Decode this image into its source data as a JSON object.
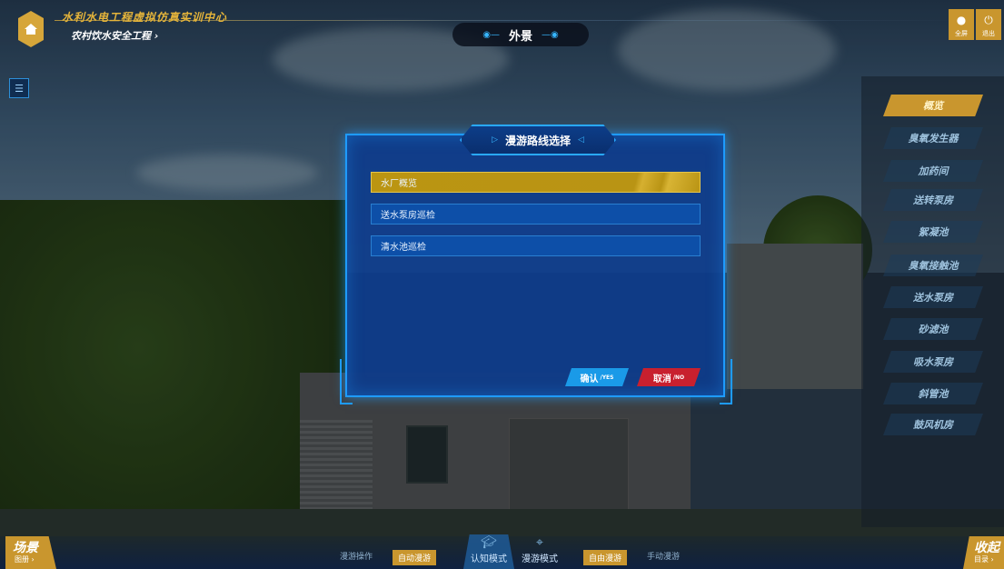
{
  "header": {
    "title": "水利水电工程虚拟仿真实训中心",
    "subtitle": "农村饮水安全工程 ›",
    "scene_label": "外景",
    "right_buttons": [
      {
        "label": "全屏",
        "icon": "person-icon"
      },
      {
        "label": "退出",
        "icon": "power-icon"
      }
    ]
  },
  "right_menu": {
    "items": [
      {
        "label": "概览",
        "active": true
      },
      {
        "label": "臭氧发生器",
        "active": false
      },
      {
        "label": "加药间",
        "active": false
      },
      {
        "label": "送转泵房",
        "active": false
      },
      {
        "label": "絮凝池",
        "active": false
      },
      {
        "label": "臭氧接触池",
        "active": false
      },
      {
        "label": "送水泵房",
        "active": false
      },
      {
        "label": "砂滤池",
        "active": false
      },
      {
        "label": "吸水泵房",
        "active": false
      },
      {
        "label": "斜管池",
        "active": false
      },
      {
        "label": "鼓风机房",
        "active": false
      }
    ]
  },
  "dialog": {
    "title": "漫游路线选择",
    "routes": [
      {
        "label": "水厂概览",
        "selected": true
      },
      {
        "label": "送水泵房巡检",
        "selected": false
      },
      {
        "label": "清水池巡检",
        "selected": false
      }
    ],
    "confirm_label": "确认",
    "confirm_sub": "/YES",
    "cancel_label": "取消",
    "cancel_sub": "/NO"
  },
  "bottom": {
    "left_big": "场景",
    "left_small": "图册 ›",
    "right_big": "收起",
    "right_small": "目录 ›",
    "nav": [
      "漫游操作",
      "自动漫游",
      "自由漫游",
      "手动漫游"
    ],
    "modes": [
      {
        "label": "认知模式",
        "icon": "graduation-cap-icon",
        "active": true
      },
      {
        "label": "漫游模式",
        "icon": "location-pin-icon",
        "active": false
      }
    ]
  },
  "colors": {
    "accent_gold": "#c9962e",
    "dialog_blue": "#0e3c8c",
    "border_cyan": "#1e9bff",
    "confirm": "#1a9ae8",
    "cancel": "#c8202e"
  }
}
